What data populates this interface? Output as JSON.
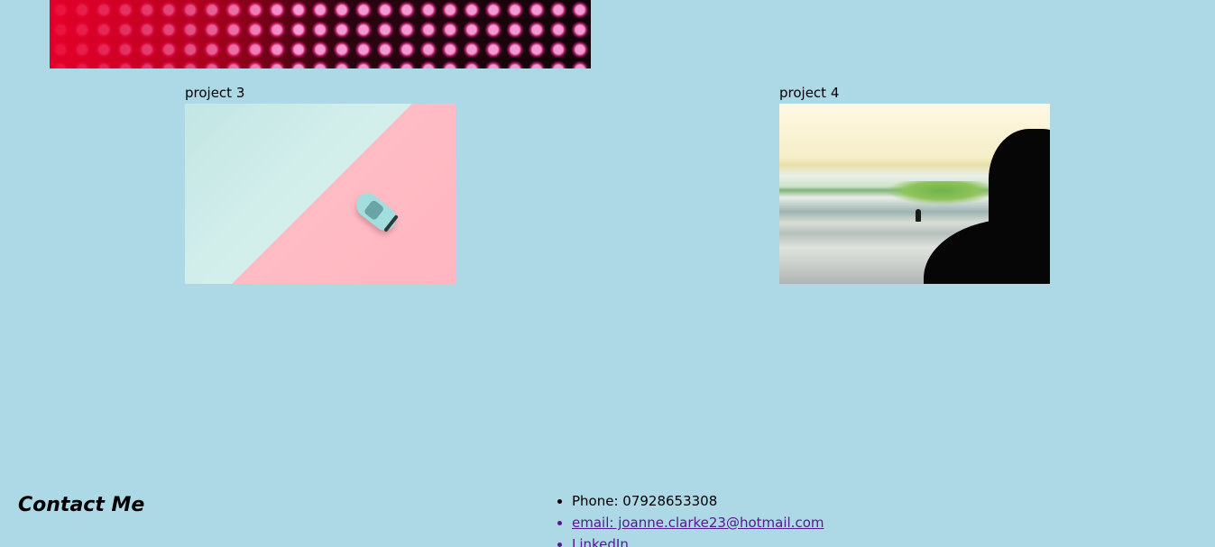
{
  "projects": [
    {
      "title": "project 3"
    },
    {
      "title": "project 4"
    }
  ],
  "footer": {
    "heading": "Contact Me",
    "phone": "Phone: 07928653308",
    "email_label": "email: joanne.clarke23@hotmail.com",
    "linkedin_label": "LinkedIn"
  },
  "colors": {
    "background": "#add8e6",
    "link": "#551a8b"
  }
}
